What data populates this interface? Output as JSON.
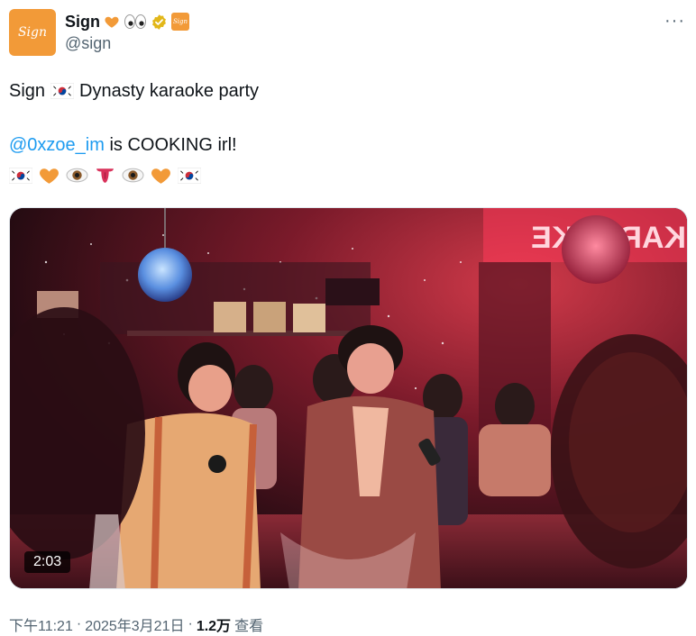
{
  "author": {
    "avatar_text": "Sign",
    "display_name": "Sign",
    "handle": "@sign",
    "name_badges": [
      "orange-heart-icon",
      "eyes-icon",
      "verified-icon",
      "sign-badge-icon"
    ],
    "badge_text": "Sign"
  },
  "more_label": "···",
  "tweet": {
    "line1_prefix": "Sign",
    "line1_suffix": "Dynasty karaoke party",
    "mention": "@0xzoe_im",
    "line2_suffix": " is COOKING irl!",
    "emoji_row": [
      "korea-flag-icon",
      "orange-heart-icon",
      "eye-icon",
      "tongue-icon",
      "eye-icon",
      "orange-heart-icon",
      "korea-flag-icon"
    ]
  },
  "media": {
    "duration": "2:03",
    "sign_text": "KARAOKE",
    "sign_small_text": "KARAOKE"
  },
  "meta": {
    "time": "下午11:21",
    "separator": "·",
    "date": "2025年3月21日",
    "views_count": "1.2万",
    "views_label": "查看"
  },
  "colors": {
    "accent_link": "#1d9bf0",
    "brand_orange": "#f29a38",
    "muted_text": "#536471"
  }
}
